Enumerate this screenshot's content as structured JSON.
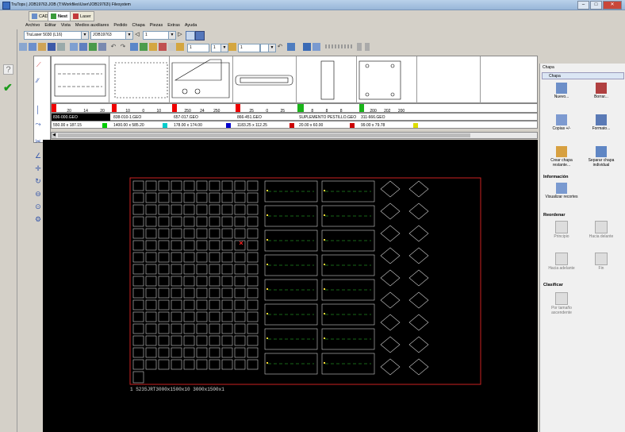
{
  "window": {
    "title": "TruTops | JOB19763.JOB (T:\\Workfiles\\User\\JOB19763\\) Filesystem",
    "controls": [
      "–",
      "□",
      "✕"
    ]
  },
  "tabs": [
    {
      "label": "CAD",
      "active": false
    },
    {
      "label": "Nest",
      "active": true
    },
    {
      "label": "Laser",
      "active": false
    }
  ],
  "menu": [
    "Archivo",
    "Editar",
    "Vista",
    "Medios auxiliares",
    "Pedido",
    "Chapa",
    "Piezas",
    "Extras",
    "Ayuda"
  ],
  "toolbar": {
    "machine": "TruLaser 5030 (L16)",
    "job": "JOB19763",
    "sheet_num": "1",
    "sheet_num2": "1",
    "field_a": "1",
    "field_b": "1",
    "field_c": "1"
  },
  "parts": [
    {
      "counts": [
        "20",
        "14",
        "20"
      ],
      "name": "836-000.GEO",
      "size": "550.00 x 187.15",
      "color": "#00cc00"
    },
    {
      "counts": [
        "10",
        "0",
        "10"
      ],
      "name": "838-010-1.GEO",
      "size": "1400.00 x 585.20",
      "color": "#00cccc"
    },
    {
      "counts": [
        "250",
        "24",
        "250"
      ],
      "name": "657-017.GEO",
      "size": "178.00 x 174.00",
      "color": "#0000cc"
    },
    {
      "counts": [
        "25",
        "0",
        "25"
      ],
      "name": "866-451.GEO",
      "size": "1183.25 x 112.25",
      "color": "#cc0000"
    },
    {
      "counts": [
        "8",
        "8",
        "8"
      ],
      "name": "SUPLEMENTO PESTILLO.GEO",
      "size": "20.00 x 60.00",
      "color": "#cc0000"
    },
    {
      "counts": [
        "200",
        "202",
        "200"
      ],
      "name": "311-666.GEO",
      "size": "99.00 x 79.78",
      "color": "#dddd00"
    }
  ],
  "right_panel": {
    "header": "Chapa",
    "tab": "Chapa",
    "buttons": {
      "new": "Nuevo...",
      "delete": "Borrar...",
      "copies": "Copias +/-",
      "format": "Formato...",
      "create_rest": "Crear chapa restante...",
      "separate": "Separar chapa individual"
    },
    "sections": {
      "info": "Información",
      "reorder": "Reordenar",
      "classify": "Clasificar"
    },
    "info_buttons": {
      "show_remnants": "Visualizar recortes"
    },
    "reorder_buttons": {
      "start": "Principio",
      "forward": "Hacia delante",
      "backward": "Hacia adelante",
      "end": "Fin"
    },
    "classify_buttons": {
      "by_size": "Por tamaño ascendente"
    }
  },
  "status_text": "1 S235JRT3000x1500x10 3000x1500x1"
}
